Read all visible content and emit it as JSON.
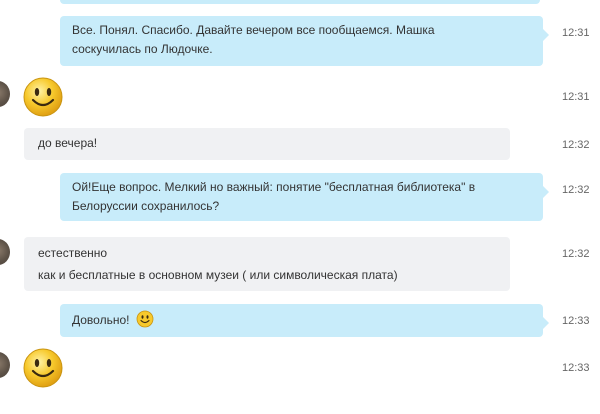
{
  "messages": [
    {
      "text_lines": [
        "Все. Понял. Спасибо. Давайте вечером все пообщаемся. Машка",
        "соскучилась по Людочке."
      ],
      "time": "12:31"
    },
    {
      "time": "12:31"
    },
    {
      "text_lines": [
        "до вечера!"
      ],
      "time": "12:32"
    },
    {
      "text_lines": [
        "Ой!Еще вопрос. Мелкий но важный: понятие \"бесплатная библиотека\" в",
        "Белоруссии сохранилось?"
      ],
      "time": "12:32"
    },
    {
      "text_lines": [
        "естественно",
        "как и бесплатные в основном музеи ( или символическая плата)"
      ],
      "time": "12:32"
    },
    {
      "text_lines": [
        "Довольно!"
      ],
      "time": "12:33"
    },
    {
      "time": "12:33"
    }
  ],
  "colors": {
    "outgoing_bubble": "#c8ecfa",
    "incoming_bubble": "#f0f1f3",
    "smiley_face": "#f7c92c"
  },
  "icons": [
    "contact-avatar",
    "smiley-emoticon"
  ]
}
